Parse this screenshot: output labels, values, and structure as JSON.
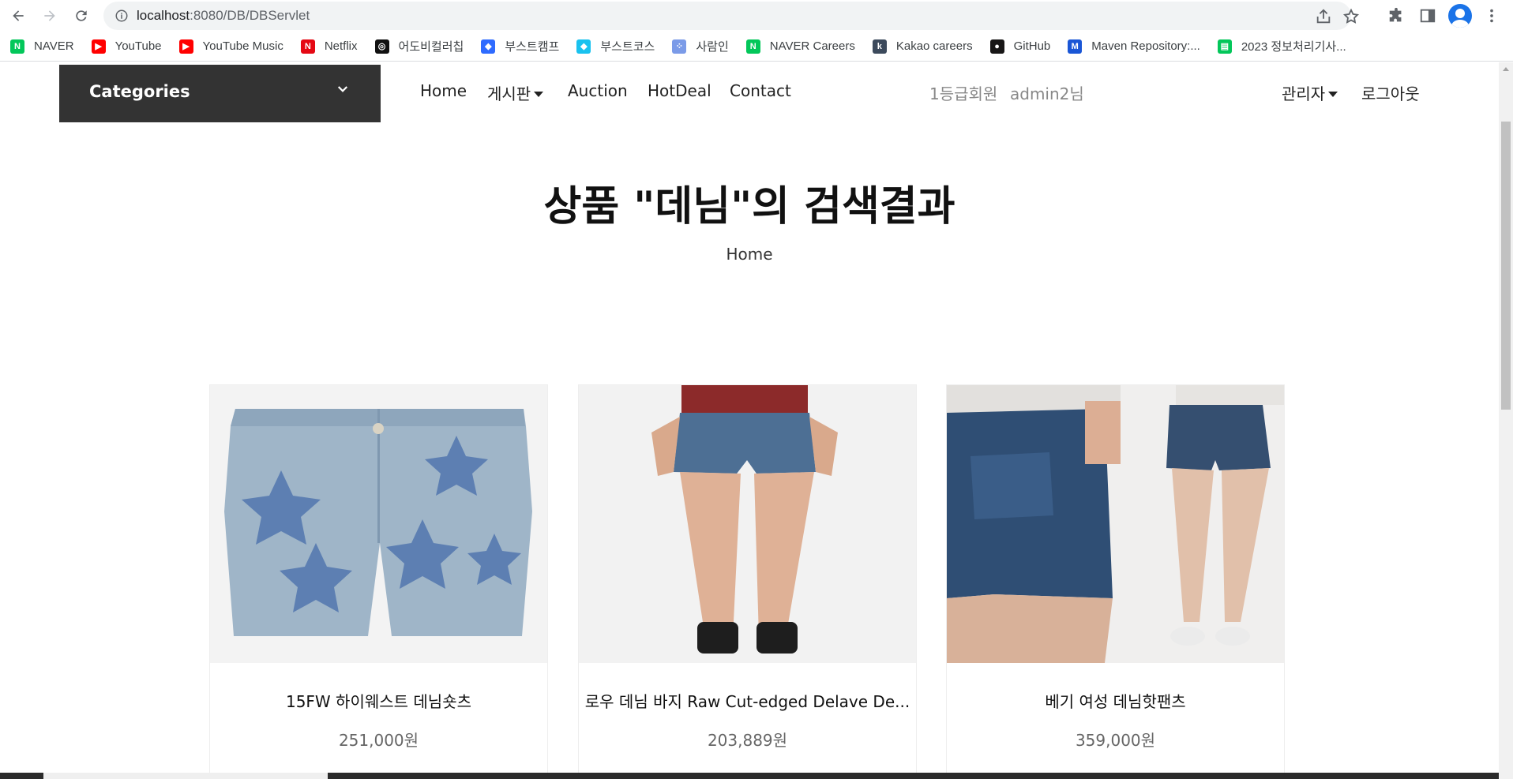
{
  "browser": {
    "url_host": "localhost",
    "url_rest": ":8080/DB/DBServlet"
  },
  "bookmarks": [
    {
      "label": "NAVER",
      "icon": "naver-icon",
      "color": "#03c75a",
      "glyph": "N"
    },
    {
      "label": "YouTube",
      "icon": "youtube-icon",
      "color": "#ff0000",
      "glyph": "▶"
    },
    {
      "label": "YouTube Music",
      "icon": "youtube-music-icon",
      "color": "#ff0000",
      "glyph": "▶"
    },
    {
      "label": "Netflix",
      "icon": "netflix-icon",
      "color": "#e50914",
      "glyph": "N"
    },
    {
      "label": "어도비컬러칩",
      "icon": "adobe-color-icon",
      "color": "#111111",
      "glyph": "◎"
    },
    {
      "label": "부스트캠프",
      "icon": "boostcamp-icon",
      "color": "#2f6bff",
      "glyph": "◆"
    },
    {
      "label": "부스트코스",
      "icon": "boostcourse-icon",
      "color": "#19c2ef",
      "glyph": "◆"
    },
    {
      "label": "사람인",
      "icon": "saramin-icon",
      "color": "#7b9be8",
      "glyph": "⁘"
    },
    {
      "label": "NAVER Careers",
      "icon": "naver-careers-icon",
      "color": "#03c75a",
      "glyph": "N"
    },
    {
      "label": "Kakao careers",
      "icon": "kakao-careers-icon",
      "color": "#3c4a5c",
      "glyph": "k"
    },
    {
      "label": "GitHub",
      "icon": "github-icon",
      "color": "#181717",
      "glyph": "●"
    },
    {
      "label": "Maven Repository:...",
      "icon": "maven-icon",
      "color": "#1a56d6",
      "glyph": "M"
    },
    {
      "label": "2023 정보처리기사...",
      "icon": "notebook-icon",
      "color": "#03c75a",
      "glyph": "▤"
    }
  ],
  "header": {
    "categories_label": "Categories",
    "menu": {
      "home": "Home",
      "board": "게시판",
      "auction": "Auction",
      "hotdeal": "HotDeal",
      "contact": "Contact"
    },
    "grade": "1등급회원",
    "username": "admin2님",
    "admin": "관리자",
    "logout": "로그아웃"
  },
  "search": {
    "title": "상품 \"데님\"의 검색결과",
    "breadcrumb": "Home"
  },
  "products": [
    {
      "name": "15FW 하이웨스트 데님숏츠",
      "price": "251,000원",
      "image": "star-denim-shorts"
    },
    {
      "name": "로우 데님 바지 Raw Cut-edged Delave De...",
      "price": "203,889원",
      "image": "model-denim-shorts"
    },
    {
      "name": "베기 여성 데님핫팬츠",
      "price": "359,000원",
      "image": "hotpants-pair"
    }
  ]
}
